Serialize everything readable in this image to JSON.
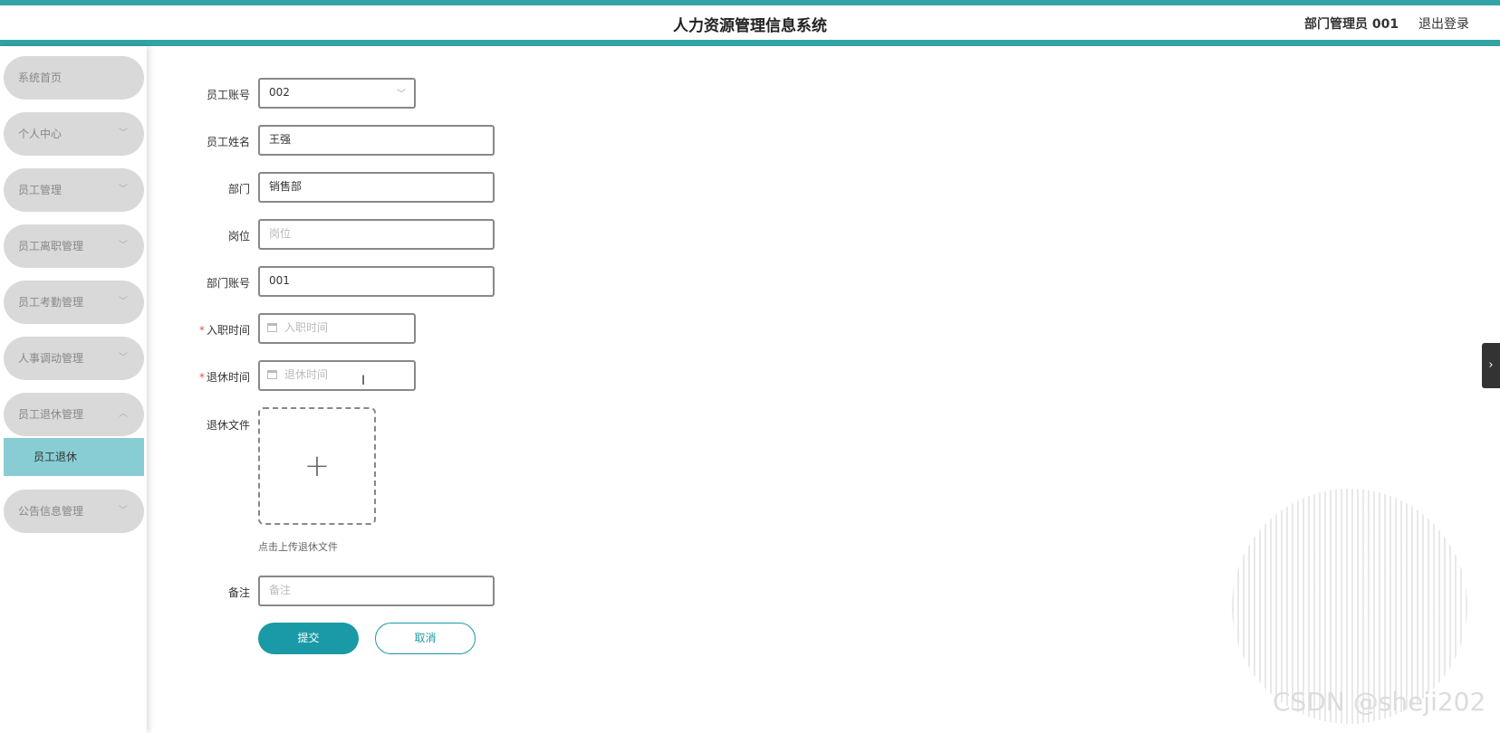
{
  "header": {
    "title": "人力资源管理信息系统",
    "user": "部门管理员 001",
    "logout": "退出登录"
  },
  "sidebar": {
    "items": [
      {
        "label": "系统首页",
        "chevron": ""
      },
      {
        "label": "个人中心",
        "chevron": "﹀"
      },
      {
        "label": "员工管理",
        "chevron": "﹀"
      },
      {
        "label": "员工离职管理",
        "chevron": "﹀"
      },
      {
        "label": "员工考勤管理",
        "chevron": "﹀"
      },
      {
        "label": "人事调动管理",
        "chevron": "﹀"
      },
      {
        "label": "员工退休管理",
        "chevron": "︿"
      },
      {
        "label": "公告信息管理",
        "chevron": "﹀"
      }
    ],
    "sub_items": [
      {
        "label": "员工退休",
        "active": true
      }
    ]
  },
  "form": {
    "employee_account": {
      "label": "员工账号",
      "value": "002"
    },
    "employee_name": {
      "label": "员工姓名",
      "value": "王强"
    },
    "department": {
      "label": "部门",
      "value": "销售部"
    },
    "position": {
      "label": "岗位",
      "placeholder": "岗位"
    },
    "department_account": {
      "label": "部门账号",
      "value": "001"
    },
    "hire_date": {
      "label": "入职时间",
      "placeholder": "入职时间",
      "required": "*"
    },
    "retire_date": {
      "label": "退休时间",
      "placeholder": "退休时间",
      "required": "*"
    },
    "retire_file": {
      "label": "退休文件",
      "plus": "+",
      "hint": "点击上传退休文件"
    },
    "remark": {
      "label": "备注",
      "placeholder": "备注"
    },
    "submit": "提交",
    "cancel": "取消"
  },
  "side_tab": {
    "icon": "›"
  },
  "watermark": "CSDN @sheji202",
  "colors": {
    "accent": "#33a3a6",
    "button": "#1a9aa6",
    "active_submenu": "#87cdd3",
    "required": "#e05252"
  }
}
